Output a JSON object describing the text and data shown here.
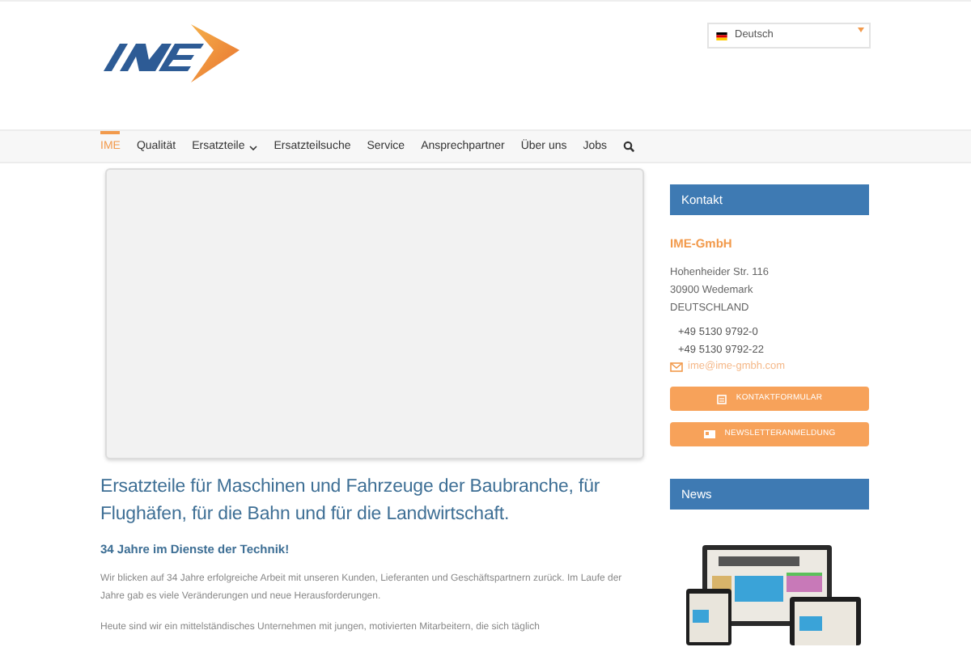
{
  "language_select": {
    "value": "Deutsch"
  },
  "nav": [
    {
      "label": "IME",
      "selected": true,
      "has_submenu": false
    },
    {
      "label": "Qualität",
      "selected": false,
      "has_submenu": false
    },
    {
      "label": "Ersatzteile",
      "selected": false,
      "has_submenu": true
    },
    {
      "label": "Ersatzteilsuche",
      "selected": false,
      "has_submenu": false
    },
    {
      "label": "Service",
      "selected": false,
      "has_submenu": false
    },
    {
      "label": "Ansprechpartner",
      "selected": false,
      "has_submenu": false
    },
    {
      "label": "Über uns",
      "selected": false,
      "has_submenu": false
    },
    {
      "label": "Jobs",
      "selected": false,
      "has_submenu": false
    }
  ],
  "main": {
    "heading": "Ersatzteile für Maschinen und Fahrzeuge der Baubranche, für Flughäfen, für die Bahn und für die Landwirtschaft.",
    "subheading": "34 Jahre im Dienste der Technik!",
    "paragraphs": [
      "Wir blicken auf 34 Jahre erfolgreiche Arbeit mit unseren Kunden, Lieferanten und Geschäftspartnern zurück. Im Laufe der Jahre gab es viele Veränderungen und neue Herausforderungen.",
      "Heute sind wir ein mittelständisches Unternehmen mit jungen, motivierten Mitarbeitern, die sich täglich"
    ]
  },
  "sidebar": {
    "contact_title": "Kontakt",
    "company": "IME-GmbH",
    "address": [
      "Hohenheider Str. 116",
      "30900 Wedemark",
      "DEUTSCHLAND"
    ],
    "phones": [
      "+49 5130 9792-0",
      "+49 5130 9792-22"
    ],
    "email": "ime@ime-gmbh.com",
    "buttons": [
      {
        "label": "KONTAKTFORMULAR",
        "kind": "form"
      },
      {
        "label": "NEWSLETTERANMELDUNG",
        "kind": "newsletter"
      }
    ],
    "news_title": "News"
  }
}
